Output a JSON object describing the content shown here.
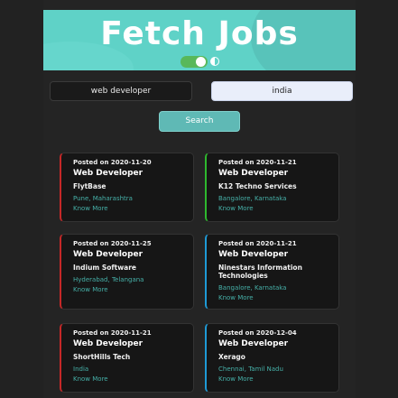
{
  "header": {
    "title": "Fetch Jobs"
  },
  "search": {
    "role_value": "web developer",
    "location_value": "india",
    "button_label": "Search"
  },
  "jobs": [
    {
      "posted": "Posted on 2020-11-20",
      "title": "Web Developer",
      "company": "FlytBase",
      "location": "Pune, Maharashtra",
      "link": "Know More",
      "accent": "#c62828"
    },
    {
      "posted": "Posted on 2020-11-21",
      "title": "Web Developer",
      "company": "K12 Techno Services",
      "location": "Bangalore, Karnataka",
      "link": "Know More",
      "accent": "#2eb82e"
    },
    {
      "posted": "Posted on 2020-11-25",
      "title": "Web Developer",
      "company": "Indium Software",
      "location": "Hyderabad, Telangana",
      "link": "Know More",
      "accent": "#c62828"
    },
    {
      "posted": "Posted on 2020-11-21",
      "title": "Web Developer",
      "company": "Ninestars Information Technologies",
      "location": "Bangalore, Karnataka",
      "link": "Know More",
      "accent": "#1e9ad6"
    },
    {
      "posted": "Posted on 2020-11-21",
      "title": "Web Developer",
      "company": "ShortHills Tech",
      "location": "India",
      "link": "Know More",
      "accent": "#c62828"
    },
    {
      "posted": "Posted on 2020-12-04",
      "title": "Web Developer",
      "company": "Xerago",
      "location": "Chennai, Tamil Nadu",
      "link": "Know More",
      "accent": "#1e9ad6"
    }
  ]
}
